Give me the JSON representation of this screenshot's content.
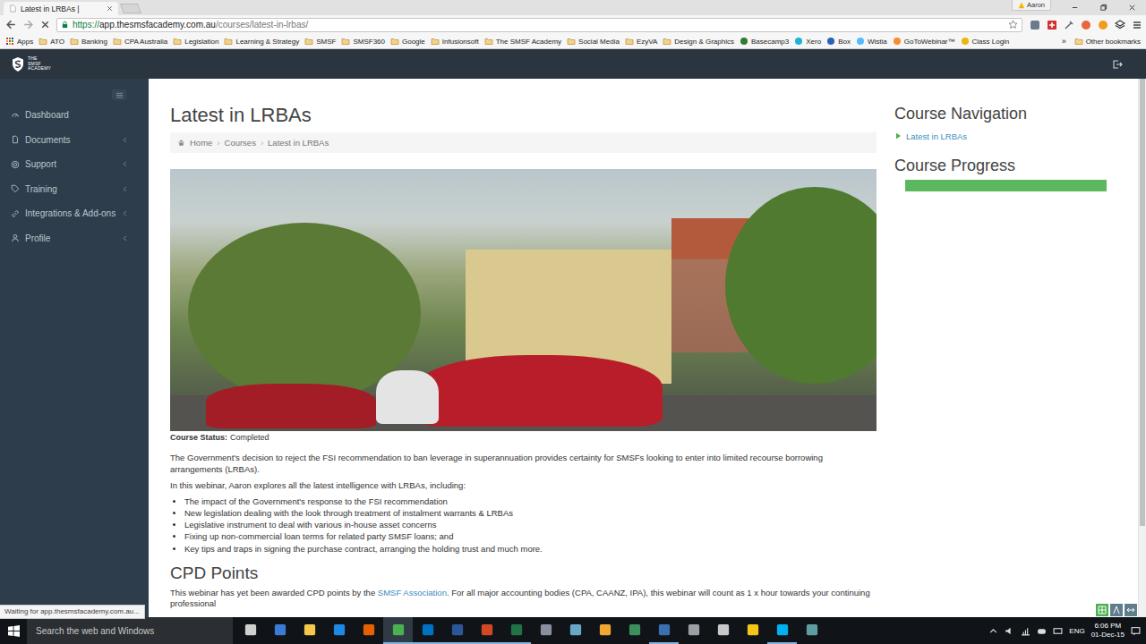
{
  "browser": {
    "tabs": [
      {
        "title": "Latest in LRBAs |",
        "selected": true
      }
    ],
    "profile": "Aaron",
    "url": {
      "scheme": "https://",
      "host": "app.thesmsfacademy.com.au",
      "path": "/courses/latest-in-lrbas/"
    },
    "bookmarks": [
      {
        "label": "Apps",
        "kind": "apps"
      },
      {
        "label": "ATO",
        "kind": "folder"
      },
      {
        "label": "Banking",
        "kind": "folder"
      },
      {
        "label": "CPA Australia",
        "kind": "folder"
      },
      {
        "label": "Legislation",
        "kind": "folder"
      },
      {
        "label": "Learning & Strategy",
        "kind": "folder"
      },
      {
        "label": "SMSF",
        "kind": "folder"
      },
      {
        "label": "SMSF360",
        "kind": "folder"
      },
      {
        "label": "Google",
        "kind": "folder"
      },
      {
        "label": "Infusionsoft",
        "kind": "folder"
      },
      {
        "label": "The SMSF Academy",
        "kind": "folder"
      },
      {
        "label": "Social Media",
        "kind": "folder"
      },
      {
        "label": "EzyVA",
        "kind": "folder"
      },
      {
        "label": "Design & Graphics",
        "kind": "folder"
      },
      {
        "label": "Basecamp3",
        "kind": "link",
        "color": "#2e7d32"
      },
      {
        "label": "Xero",
        "kind": "link",
        "color": "#1ab4d7"
      },
      {
        "label": "Box",
        "kind": "link",
        "color": "#2a62b7"
      },
      {
        "label": "Wistia",
        "kind": "link",
        "color": "#54bbff"
      },
      {
        "label": "GoToWebinar™",
        "kind": "link",
        "color": "#f68d2e"
      },
      {
        "label": "Class Login",
        "kind": "link",
        "color": "#e8b80c"
      }
    ],
    "more": "»",
    "other_bookmarks": "Other bookmarks",
    "status": "Waiting for app.thesmsfacademy.com.au..."
  },
  "app": {
    "logo_lines": [
      "THE",
      "SMSF",
      "ACADEMY"
    ],
    "sidebar": [
      {
        "label": "Dashboard",
        "has_submenu": false
      },
      {
        "label": "Documents",
        "has_submenu": true
      },
      {
        "label": "Support",
        "has_submenu": true
      },
      {
        "label": "Training",
        "has_submenu": true
      },
      {
        "label": "Integrations & Add-ons",
        "has_submenu": true
      },
      {
        "label": "Profile",
        "has_submenu": true
      }
    ],
    "page": {
      "title": "Latest in LRBAs",
      "breadcrumb": [
        {
          "label": "Home",
          "link": true
        },
        {
          "label": "Courses",
          "link": true
        },
        {
          "label": "Latest in LRBAs",
          "link": false
        }
      ],
      "breadcrumb_separator": "›",
      "status_label": "Course Status:",
      "status": "Completed",
      "paragraphs": [
        "The Government's decision to reject the FSI recommendation to ban leverage in superannuation provides certainty for SMSFs looking to enter into limited recourse borrowing arrangements (LRBAs).",
        "In this webinar, Aaron explores all the latest intelligence with LRBAs, including:"
      ],
      "bullets": [
        "The impact of the Government's response to the FSI recommendation",
        "New legislation dealing with the look through treatment of instalment warrants & LRBAs",
        "Legislative instrument to deal with various in-house asset concerns",
        "Fixing up non-commercial loan terms for related party SMSF loans; and",
        "Key tips and traps in signing the purchase contract, arranging the holding trust and much more."
      ],
      "cpd_heading": "CPD Points",
      "cpd_before": "This webinar has yet been awarded CPD points by the ",
      "cpd_link": "SMSF Association",
      "cpd_after": ". For all major accounting bodies (CPA, CAANZ, IPA), this webinar will count as 1 x hour towards your continuing professional"
    },
    "course_navigation": {
      "title": "Course Navigation",
      "items": [
        {
          "label": "Latest in LRBAs",
          "selected": true
        }
      ]
    },
    "course_progress": {
      "title": "Course Progress",
      "level": 1.0
    }
  },
  "taskbar": {
    "search_placeholder": "Search the web and Windows",
    "apps": [
      {
        "color": "#d0d0d0",
        "running": false,
        "selected": false
      },
      {
        "color": "#3a7bd5",
        "running": false,
        "selected": false
      },
      {
        "color": "#f2c94c",
        "running": false,
        "selected": false
      },
      {
        "color": "#1e88e5",
        "running": false,
        "selected": false
      },
      {
        "color": "#e66000",
        "running": false,
        "selected": false
      },
      {
        "color": "#4caf50",
        "running": true,
        "selected": true
      },
      {
        "color": "#0072c6",
        "running": true,
        "selected": false
      },
      {
        "color": "#2b579a",
        "running": true,
        "selected": false
      },
      {
        "color": "#d24726",
        "running": true,
        "selected": false
      },
      {
        "color": "#217346",
        "running": true,
        "selected": false
      },
      {
        "color": "#8a8fa0",
        "running": false,
        "selected": false
      },
      {
        "color": "#6aa6c8",
        "running": false,
        "selected": false
      },
      {
        "color": "#f0a830",
        "running": false,
        "selected": false
      },
      {
        "color": "#3b8f5a",
        "running": false,
        "selected": false
      },
      {
        "color": "#3a6fb0",
        "running": true,
        "selected": false
      },
      {
        "color": "#9aa0a6",
        "running": false,
        "selected": false
      },
      {
        "color": "#c8c8c8",
        "running": false,
        "selected": false
      },
      {
        "color": "#f5c518",
        "running": false,
        "selected": false
      },
      {
        "color": "#00aff0",
        "running": true,
        "selected": false
      },
      {
        "color": "#5f9ea0",
        "running": false,
        "selected": false
      }
    ],
    "language": "ENG",
    "time": "6:06 PM",
    "date": "01-Dec-15"
  }
}
